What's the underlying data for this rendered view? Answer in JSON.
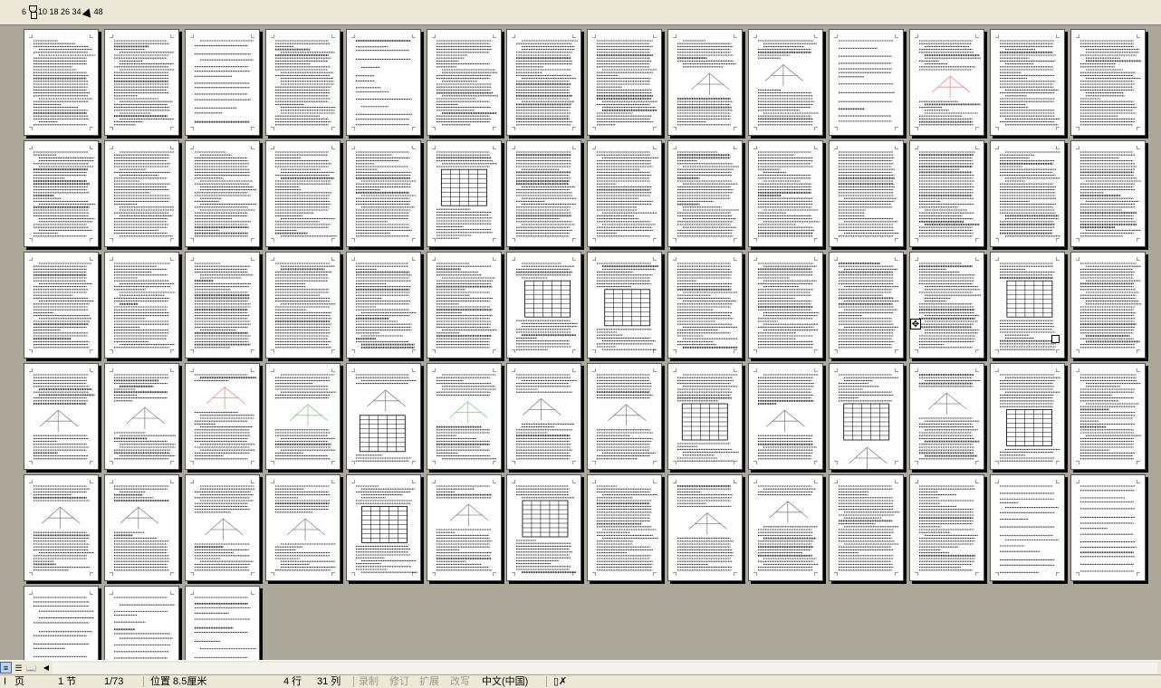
{
  "ruler": {
    "left_mark": "6",
    "tabs_text": "10 18 26 34",
    "right_mark": "48"
  },
  "view_buttons": [
    {
      "name": "normal-view-button",
      "glyph": "≡"
    },
    {
      "name": "web-layout-view-button",
      "glyph": "☰"
    },
    {
      "name": "reading-view-button",
      "glyph": "📖"
    }
  ],
  "status": {
    "page": "页",
    "section": "1 节",
    "page_of": "1/73",
    "position": "位置 8.5厘米",
    "line": "4 行",
    "column": "31 列",
    "rec": "录制",
    "trk": "修订",
    "ext": "扩展",
    "ovr": "改写",
    "language": "中文(中国)"
  },
  "pages": {
    "total": 73,
    "per_row": 14
  }
}
